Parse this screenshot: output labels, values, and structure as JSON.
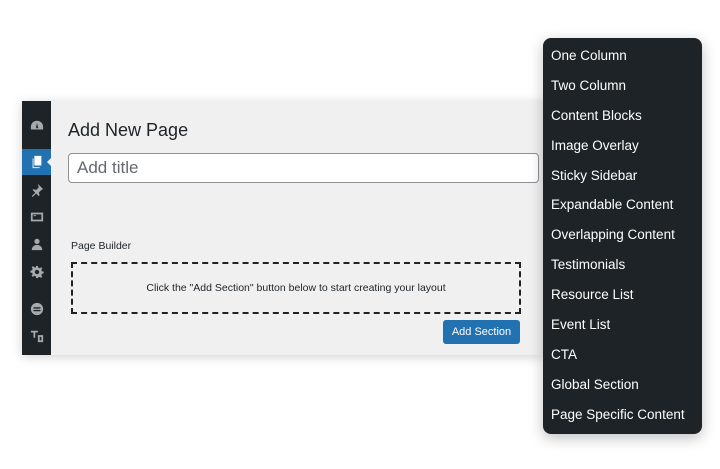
{
  "sidebar": {
    "icons": [
      {
        "name": "dashboard-icon"
      },
      {
        "name": "pages-icon",
        "active": true
      },
      {
        "name": "pin-icon"
      },
      {
        "name": "media-icon"
      },
      {
        "name": "users-icon"
      },
      {
        "name": "settings-icon"
      },
      {
        "name": "plugin-icon"
      },
      {
        "name": "translate-icon"
      }
    ]
  },
  "editor": {
    "heading": "Add New Page",
    "title_placeholder": "Add title",
    "builder_label": "Page Builder",
    "dropzone_text": "Click the \"Add Section\" button below to start creating your layout",
    "add_section_label": "Add Section"
  },
  "menu": {
    "items": [
      "One Column",
      "Two Column",
      "Content Blocks",
      "Image Overlay",
      "Sticky Sidebar",
      "Expandable Content",
      "Overlapping Content",
      "Testimonials",
      "Resource List",
      "Event List",
      "CTA",
      "Global Section",
      "Page Specific Content"
    ]
  },
  "colors": {
    "sidebar_bg": "#1d2327",
    "accent": "#2271b1",
    "menu_bg": "#1d2327",
    "editor_bg": "#f0f0f1"
  }
}
